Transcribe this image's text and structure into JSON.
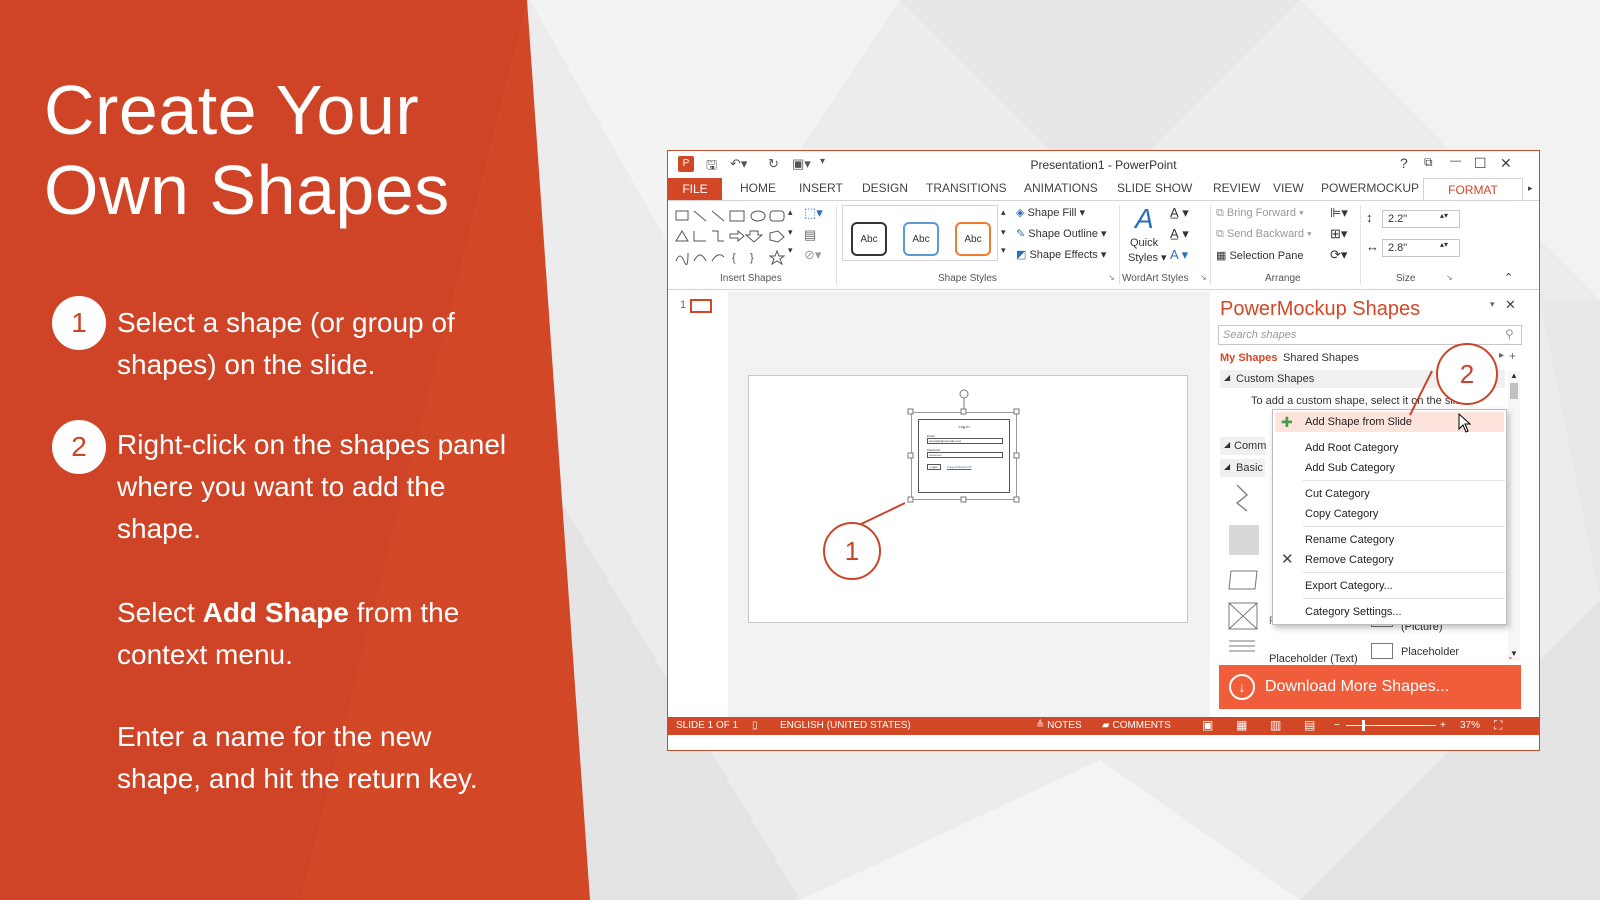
{
  "slide": {
    "title_line1": "Create Your",
    "title_line2": "Own Shapes",
    "step1": {
      "num": "1",
      "text": "Select a shape (or group of shapes) on the slide."
    },
    "step2": {
      "num": "2",
      "text": "Right-click on the shapes panel where you want to add the shape."
    },
    "para3_pre": "Select ",
    "para3_bold": "Add Shape",
    "para3_post": " from the context menu.",
    "para4": "Enter a name for the new shape, and hit the return key.",
    "accent_color": "#d24726"
  },
  "window": {
    "title": "Presentation1 - PowerPoint",
    "controls": {
      "help": "?",
      "restore_ribbon": "⧉",
      "minimize": "—",
      "maximize": "☐",
      "close": "✕"
    },
    "tabs": [
      "HOME",
      "INSERT",
      "DESIGN",
      "TRANSITIONS",
      "ANIMATIONS",
      "SLIDE SHOW",
      "REVIEW",
      "VIEW",
      "POWERMOCKUP"
    ],
    "tab_file": "FILE",
    "tab_active": "FORMAT",
    "ribbon": {
      "insert_shapes_label": "Insert Shapes",
      "shape_styles_label": "Shape Styles",
      "wordart_label": "WordArt Styles",
      "arrange_label": "Arrange",
      "size_label": "Size",
      "abc": "Abc",
      "shape_fill": "Shape Fill",
      "shape_outline": "Shape Outline",
      "shape_effects": "Shape Effects",
      "quick_styles_line1": "Quick",
      "quick_styles_line2": "Styles",
      "bring_forward": "Bring Forward",
      "send_backward": "Send Backward",
      "selection_pane": "Selection Pane",
      "height": "2.2\"",
      "width": "2.8\""
    },
    "slide_number": "1",
    "mock": {
      "title": "Log In",
      "email_label": "Email",
      "email_value": "example@example.com",
      "password_label": "Password",
      "password_value": "••••••••••••",
      "login_button": "Login",
      "forgot_link": "Forgot Password?"
    },
    "panel": {
      "title": "PowerMockup Shapes",
      "search_placeholder": "Search shapes",
      "tab_my": "My Shapes",
      "tab_shared": "Shared Shapes",
      "custom_shapes": "Custom Shapes",
      "hint_line1": "To add a custom shape, select it on the slide",
      "hint_line2": "ri",
      "common": "Comm",
      "basic": "Basic",
      "placeholder_picture": "(Picture)",
      "placeholder": "Placeholder",
      "placeholder_text": "Placeholder (Text)",
      "partial_label": "Placeholder",
      "download": "Download More Shapes..."
    },
    "context_menu": [
      "Add Shape from Slide",
      "Add Root Category",
      "Add Sub Category",
      "Cut Category",
      "Copy Category",
      "Rename Category",
      "Remove Category",
      "Export Category...",
      "Category Settings..."
    ],
    "status": {
      "slide_of": "SLIDE 1 OF 1",
      "language": "ENGLISH (UNITED STATES)",
      "notes": "NOTES",
      "comments": "COMMENTS",
      "zoom": "37%"
    },
    "callout1": "1",
    "callout2": "2"
  }
}
